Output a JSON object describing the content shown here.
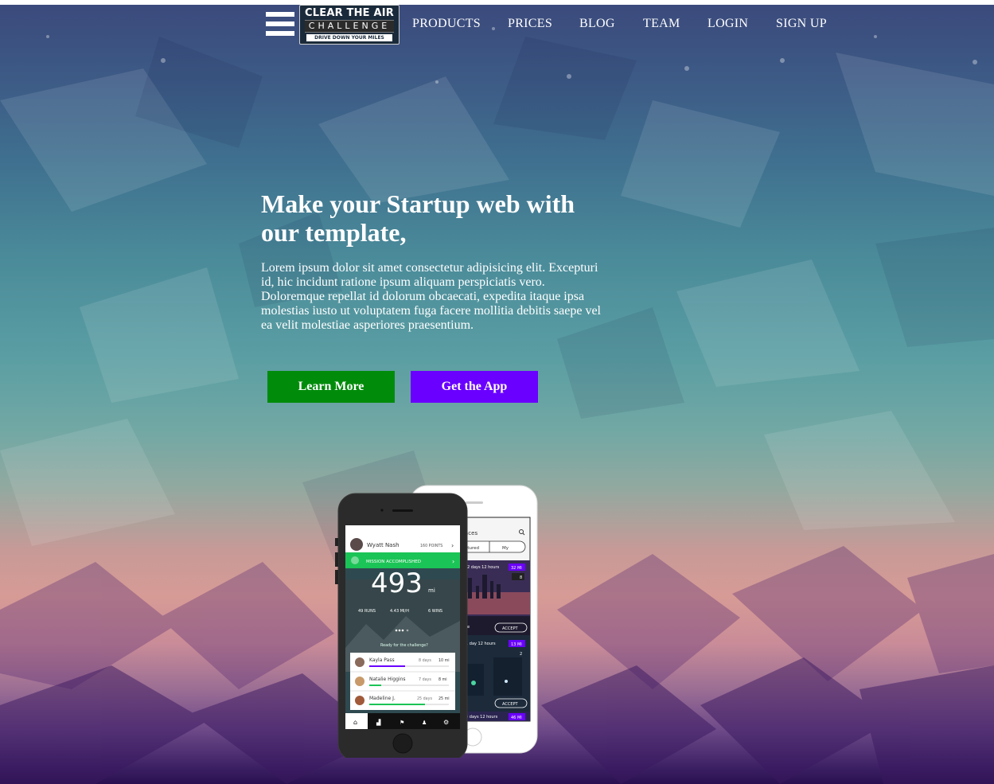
{
  "colors": {
    "learn_more_bg": "#008c0a",
    "get_app_bg": "#6a00ff",
    "mission_green": "#1bc456",
    "distance_badge": "#6a00ff"
  },
  "nav": {
    "menu_icon": "hamburger-icon",
    "logo": {
      "line1": "CLEAR THE AIR",
      "line2": "CHALLENGE",
      "tagline": "DRIVE DOWN YOUR MILES"
    },
    "items": [
      {
        "label": "PRODUCTS"
      },
      {
        "label": "PRICES"
      },
      {
        "label": "BLOG"
      },
      {
        "label": "TEAM"
      },
      {
        "label": "LOGIN"
      },
      {
        "label": "SIGN UP"
      }
    ]
  },
  "hero": {
    "title": "Make your Startup web with our template,",
    "lead": "Lorem ipsum dolor sit amet consectetur adipisicing elit. Excepturi id, hic incidunt ratione ipsum aliquam perspiciatis vero. Doloremque repellat id dolorum obcaecati, expedita itaque ipsa molestias iusto ut voluptatem fuga facere mollitia debitis saepe vel ea velit molestiae asperiores praesentium.",
    "learn_more_label": "Learn More",
    "get_app_label": "Get the App"
  },
  "phone_front": {
    "user_name": "Wyatt Nash",
    "points": "160 POINTS",
    "mission": "MISSION ACCOMPLISHED",
    "big_number": "493",
    "unit": "mi",
    "stats": [
      "49 RUNS",
      "4.43 MI/H",
      "6 WINS"
    ],
    "prompt": "Ready for the challenge?",
    "leaders": [
      {
        "name": "Kayla Pass",
        "days": "8 days",
        "miles": "10 mi",
        "progress": 0.45
      },
      {
        "name": "Natalie Higgins",
        "days": "7 days",
        "miles": "8 mi",
        "progress": 0.15
      },
      {
        "name": "Madeline J.",
        "days": "25 days",
        "miles": "25 mi",
        "progress": 0.7
      }
    ]
  },
  "phone_back": {
    "header": "aces",
    "tabs": [
      "atured",
      "My"
    ],
    "cards": [
      {
        "time": "2 days 12 hours",
        "miles": "32 MI",
        "count": "8",
        "action": "ACCEPT",
        "label": "e"
      },
      {
        "time": "1 day 12 hours",
        "miles": "13 MI",
        "count": "2",
        "action": "ACCEPT",
        "label": "3"
      },
      {
        "time": "3 days 12 hours",
        "miles": "46 MI",
        "label": "3"
      }
    ]
  }
}
